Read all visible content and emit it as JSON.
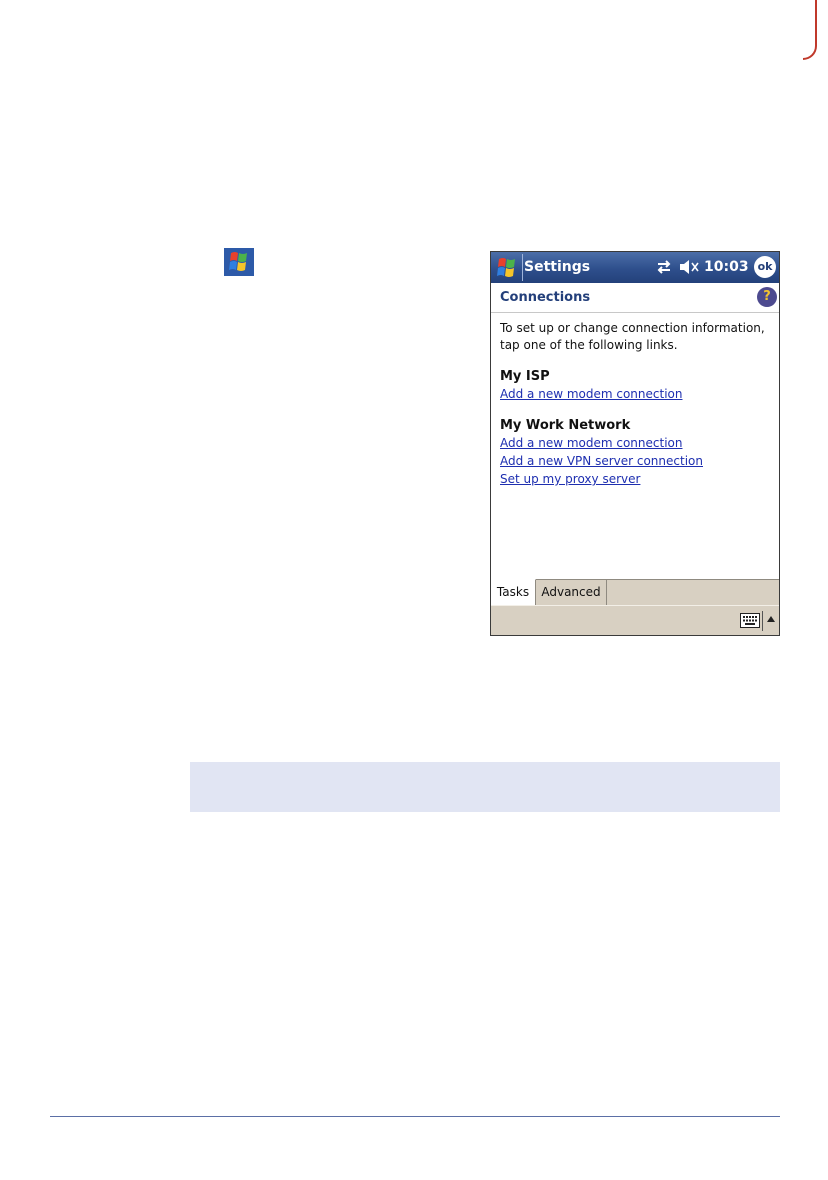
{
  "colors": {
    "title_bar": "#2e4f8c",
    "header_text": "#233f7a",
    "link": "#1e2fb0",
    "tab_bar": "#d8d0c2",
    "note_box": "#e1e5f3",
    "footer_rule": "#5b6fa6",
    "edge_mark": "#c0392b"
  },
  "icons": {
    "page_start": "windows-start-icon",
    "title_start": "windows-start-icon",
    "connectivity": "connectivity-arrows-icon",
    "volume": "volume-muted-icon",
    "help": "help-icon",
    "keyboard": "keyboard-icon",
    "input_menu": "arrow-up-icon"
  },
  "device": {
    "title_bar": {
      "title": "Settings",
      "time": "10:03",
      "ok_label": "ok"
    },
    "header": {
      "title": "Connections",
      "help_label": "?"
    },
    "intro": "To set up or change connection information, tap one of the following links.",
    "sections": [
      {
        "title": "My ISP",
        "links": [
          "Add a new modem connection"
        ]
      },
      {
        "title": "My Work Network",
        "links": [
          "Add a new modem connection",
          "Add a new VPN server connection",
          "Set up my proxy server"
        ]
      }
    ],
    "tabs": [
      "Tasks",
      "Advanced"
    ],
    "active_tab": "Tasks"
  }
}
